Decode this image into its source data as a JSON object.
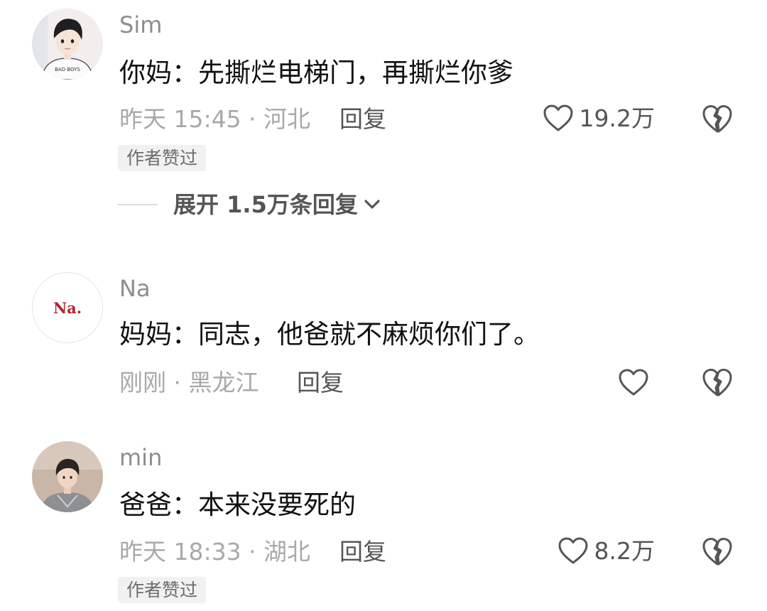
{
  "comments": [
    {
      "username": "Sim",
      "avatar_text": "BAD BOYS",
      "content": "你妈：先撕烂电梯门，再撕烂你爹",
      "meta": "昨天 15:45 · 河北",
      "reply_label": "回复",
      "like_count": "19.2万",
      "badge": "作者赞过",
      "expand_replies": "展开 1.5万条回复"
    },
    {
      "username": "Na",
      "avatar_text": "Na.",
      "content": "妈妈：同志，他爸就不麻烦你们了。",
      "meta": "刚刚 · 黑龙江",
      "reply_label": "回复",
      "like_count": ""
    },
    {
      "username": "min",
      "content": "爸爸：本来没要死的",
      "meta": "昨天 18:33 · 湖北",
      "reply_label": "回复",
      "like_count": "8.2万",
      "badge": "作者赞过"
    }
  ],
  "colors": {
    "username": "#8e8e8e",
    "content": "#111111",
    "meta": "#a9a9a9",
    "action": "#555555",
    "badge_bg": "#f1f1f1",
    "avatar_na_text": "#b3262b"
  },
  "icons": {
    "like": "heart-outline-icon",
    "dislike": "broken-heart-icon",
    "expand": "chevron-down-icon"
  }
}
